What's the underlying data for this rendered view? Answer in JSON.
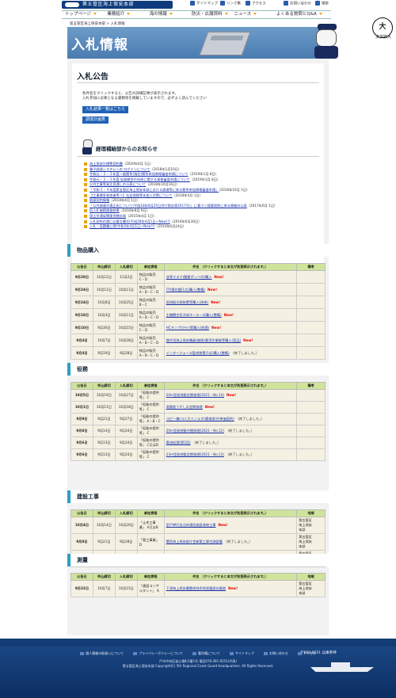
{
  "header": {
    "org_name": "第五管区海上保安本部",
    "utility": [
      "サイトマップ",
      "リンク集",
      "アクセス",
      "お問い合わせ",
      "検索"
    ],
    "nav": [
      "トップページ",
      "業務紹介",
      "海の情報",
      "防災・広報資料",
      "ニュース",
      "よくある質問とQ&A"
    ],
    "text_size_icon": "大",
    "text_size_label": "文字拡大",
    "breadcrumb": "第五管区海上保安本部 > 入札情報"
  },
  "banner": {
    "title": "入札情報"
  },
  "page": {
    "heading": "入札公告",
    "intro_line1": "各件名をクリックすると、公告の詳細記事が表示されます。",
    "intro_line2": "入札参加に必要となる書類等を掲載していますので、必ずよく読んでください",
    "btn_results": "入札結果一覧はこちら",
    "btn_plan": "調達計画表"
  },
  "news": {
    "title": "経理補給部からのお知らせ",
    "items": [
      {
        "text": "海上保安庁標準契約書",
        "date": "（2020年4月 1日）"
      },
      {
        "text": "電子調達システムへの ログインについて",
        "date": "（2018年1月10日）"
      },
      {
        "text": "令和元・２・３年度一般競争(指名)競争参加資格審査申請について",
        "date": "（2019年1月 8日）"
      },
      {
        "text": "令和元・２・３年度 役務競争の技術に関する資格審査申請について",
        "date": "（2019年1月 8日）"
      },
      {
        "text": "公共工事等発注見通しの公表について",
        "date": "（2018年10月16日）"
      },
      {
        "text": "「令和３・４年度第五管区海上保安本部における調達等に係る競争参加資格審査申請」",
        "date": "（2018年10月 1日）"
      },
      {
        "text": "【工事競争参加者等へ】社会保険等未加入対策について",
        "date": "（2018年4月 1日）"
      },
      {
        "text": "随意契約情報",
        "date": "（2018年4月 1日）"
      },
      {
        "text": "「公共調達の適正化について(平成18年8月25日付け財計第2017号)」に基づく随意契約に係る情報の公表",
        "date": "（2017年6月 1日）"
      },
      {
        "text": "低入札価格調査結果",
        "date": "（2016年8月 9日）"
      },
      {
        "text": "国土交通省関連営繕計画",
        "date": "（2015年4月 1日）"
      },
      {
        "text": "入札契約の際に必要な書式(平成28年4月1日〜New!!)",
        "date": "（2016年6月30日）"
      },
      {
        "text": "入札・見積書心得(令和3年4月1日〜New!!)",
        "date": "（2014年6月24日）"
      }
    ]
  },
  "table_headers": {
    "koukoku": "公告日",
    "shinsei": "申込締切",
    "nyusatsu": "入札締切",
    "sanka": "参加資格",
    "kenmei": "件名 （クリックすると本文が別窓表示されます。）",
    "biko": "備考",
    "chiiki": "地域"
  },
  "sections": [
    {
      "title": "物品購入",
      "rows": [
        {
          "date": "9月28日",
          "app": "10月12日",
          "bid": "11月2日",
          "qual": "物品の販売\nC・D",
          "name": "非常マスク(酸素ボンベ付)購入",
          "status": "New!"
        },
        {
          "date": "9月24日",
          "app": "10月11日",
          "bid": "10月11日",
          "qual": "物品の販売\nA・B・C・D",
          "name": "ITV操作盤(1式)購入(整備)",
          "status": "New!"
        },
        {
          "date": "9月24日",
          "app": "10月8日",
          "bid": "10月25日",
          "qual": "物品の販売\nB・C",
          "name": "巡視艇光源装置等購入(改修)",
          "status": "New!"
        },
        {
          "date": "9月18日",
          "app": "10月4日",
          "bid": "10月11日",
          "qual": "物品の販売\nA・B・C・D",
          "name": "主機関空気冷却ホース一式購入(整備)",
          "status": "New!"
        },
        {
          "date": "9月10日",
          "app": "9月30日",
          "bid": "10月15日",
          "qual": "物品の販売\nC・D",
          "name": "HCランプ(ﾎﾜｲﾄ)等購入(修理)",
          "status": "New!"
        },
        {
          "date": "9月4日",
          "app": "10月7日",
          "bid": "10月28日",
          "qual": "物品の販売\nA・B・C・D",
          "name": "操作用海上保安職員(被服)夏用作業服等購入(実品)",
          "status": "New!"
        },
        {
          "date": "9月4日",
          "app": "9月19日",
          "bid": "9月28日",
          "qual": "物品の販売\nA・B・C・D",
          "name": "インターフォース監視装置(1式)購入(整備)",
          "status": "（終了しました。）"
        }
      ]
    },
    {
      "title": "役務",
      "rows": [
        {
          "date": "10月5日",
          "app": "10月19日",
          "bid": "10月27日",
          "qual": "「役務の提供等」 C",
          "name": "20m型巡視艇定期修理(2021・No.14)",
          "status": "New!"
        },
        {
          "date": "10月1日",
          "app": "10月11日",
          "bid": "10月18日",
          "qual": "「役務の提供等」 C",
          "name": "測量船うずしお定期修理",
          "status": "New!"
        },
        {
          "date": "9月9日",
          "app": "9月21日",
          "bid": "9月27日",
          "qual": "「役務の提供等」 A・B・C",
          "name": "コピー機(コニカミノルタ)賃借保守(単価契約)",
          "status": "（終了しました。）"
        },
        {
          "date": "9月8日",
          "app": "9月14日",
          "bid": "9月24日",
          "qual": "「役務の提供等」 C",
          "name": "20m型巡視艇中間修理(2021・No.12)",
          "status": "（終了しました。）"
        },
        {
          "date": "9月6日",
          "app": "9月13日",
          "bid": "9月24日",
          "qual": "「役務の提供等」 C又はD",
          "name": "廃油処理(第2回)",
          "status": "（終了しました。）"
        },
        {
          "date": "9月6日",
          "app": "9月13日",
          "bid": "9月24日",
          "qual": "「役務の提供等」 C",
          "name": "23m型巡視艇定期修理(2021・No.13)",
          "status": "（終了しました。）"
        }
      ]
    },
    {
      "title": "建設工事",
      "rows": [
        {
          "date": "10月4日",
          "app": "10月14日",
          "bid": "10月20日",
          "qual": "「土木工事業」 A又はB",
          "name": "室戸岬灯台沿岸通信施設改修工事",
          "status": "New!",
          "area": "第五管区\n海上保安\n本部"
        },
        {
          "date": "9月8日",
          "app": "9月21日",
          "bid": "9月28日",
          "qual": "「管工事業」 D",
          "name": "関西海上保安部庁舎新築工事空調設備",
          "status": "（終了しました。）",
          "area": "第五管区\n海上保安\n本部"
        },
        {
          "date": "9月3日",
          "app": "9月17日",
          "bid": "9月28日",
          "qual": "「土木工事業」 B又はC",
          "name": "明石海峡航路東方灯浮標建造工事(基本交換工事)(その1)",
          "status": "（終了しました。）",
          "area": "第五管区\n海上保安\n本部"
        }
      ]
    },
    {
      "title": "測量",
      "rows": [
        {
          "date": "9月22日",
          "app": "10月7日",
          "bid": "10月15日",
          "qual": "「建設コンサルタント」 A",
          "name": "下津海上保安署敷地残余地測量設計業務",
          "status": "New!",
          "area": "第五管区\n海上保安\n本部"
        }
      ]
    }
  ],
  "footer": {
    "links": [
      "個人情報の取扱いについて",
      "プライバシーポリシーについて",
      "著作権について",
      "サイトマップ",
      "お問い合わせ",
      "アクセス"
    ],
    "zip": "〒650-8551 兵庫県神",
    "address": "戸市中央区波止場町1番1号 電話078-391-6551(代表)",
    "copyright": "第五管区海上保安本部 Copyright(C) 5th Regional Coast Guard Headquarters. All Rights Reserved."
  }
}
